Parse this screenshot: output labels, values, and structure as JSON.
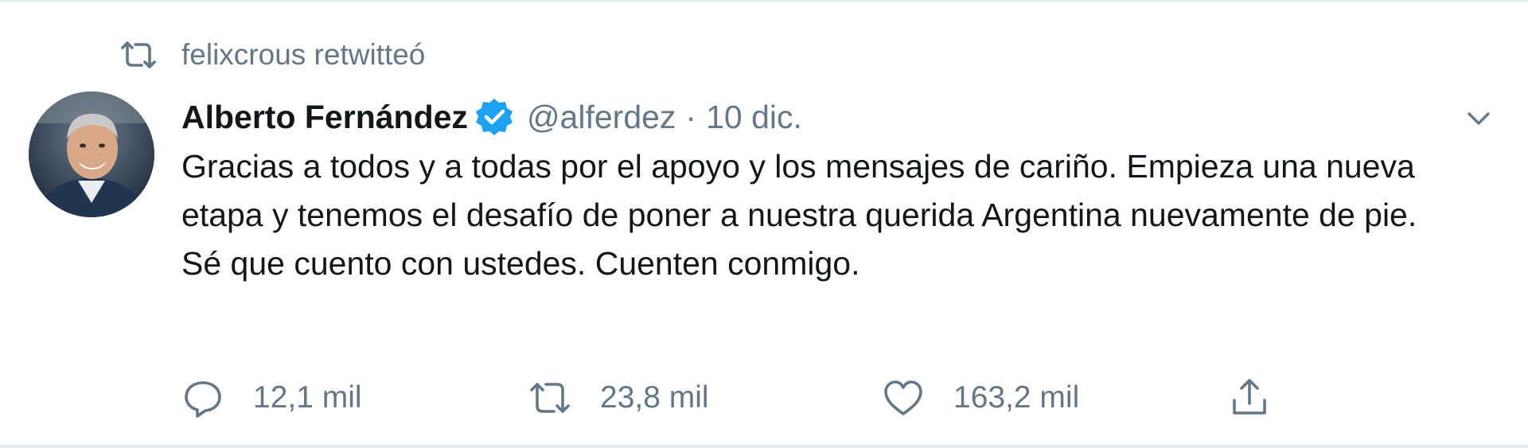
{
  "retweet_context": {
    "text": "felixcrous retwitteó",
    "icon": "retweet-icon"
  },
  "tweet": {
    "display_name": "Alberto Fernández",
    "verified": true,
    "handle": "@alferdez",
    "separator": "·",
    "date": "10 dic.",
    "text": "Gracias a todos y a todas por el apoyo y los mensajes de cariño. Empieza una nueva etapa y tenemos el desafío de poner a nuestra querida Argentina nuevamente de pie. Sé que cuento con ustedes. Cuenten conmigo."
  },
  "actions": {
    "replies": "12,1 mil",
    "retweets": "23,8 mil",
    "likes": "163,2 mil"
  },
  "colors": {
    "secondary_text": "#657786",
    "primary_text": "#14171a",
    "verified_blue": "#1da1f2",
    "border": "#e6ecf0"
  }
}
